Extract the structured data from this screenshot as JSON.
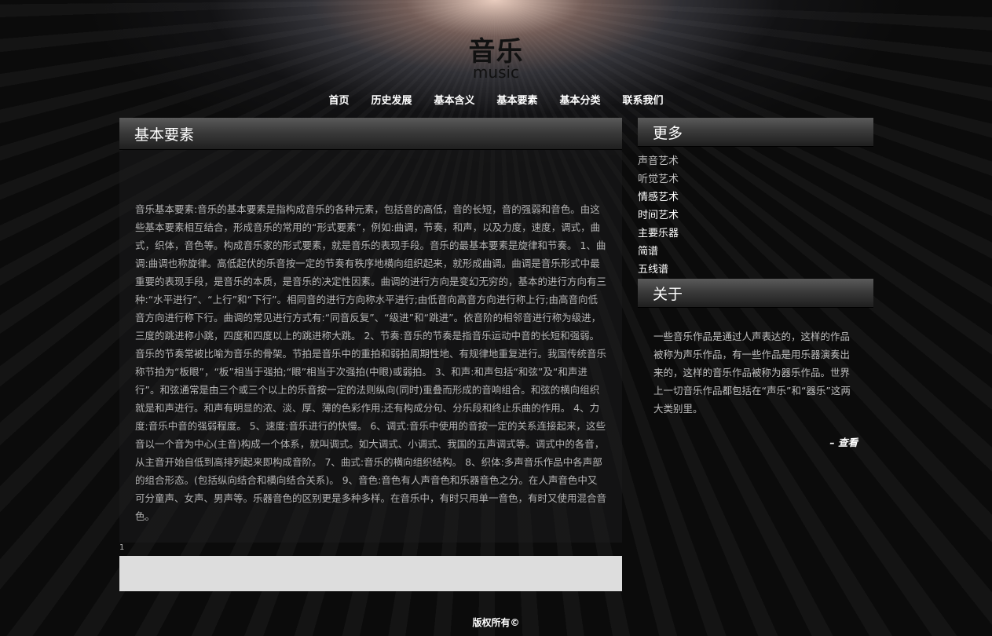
{
  "header": {
    "title": "音乐",
    "subtitle": "music"
  },
  "nav": {
    "items": [
      {
        "label": "首页"
      },
      {
        "label": "历史发展"
      },
      {
        "label": "基本含义"
      },
      {
        "label": "基本要素"
      },
      {
        "label": "基本分类"
      },
      {
        "label": "联系我们"
      }
    ]
  },
  "main": {
    "heading": "基本要素",
    "body": "音乐基本要素:音乐的基本要素是指构成音乐的各种元素，包括音的高低，音的长短，音的强弱和音色。由这些基本要素相互结合，形成音乐的常用的“形式要素”，例如:曲调，节奏，和声，以及力度，速度，调式，曲式，织体，音色等。构成音乐家的形式要素，就是音乐的表现手段。音乐的最基本要素是旋律和节奏。 1、曲调:曲调也称旋律。高低起伏的乐音按一定的节奏有秩序地横向组织起来，就形成曲调。曲调是音乐形式中最重要的表现手段，是音乐的本质，是音乐的决定性因素。曲调的进行方向是变幻无穷的，基本的进行方向有三种:“水平进行”、“上行”和“下行”。相同音的进行方向称水平进行;由低音向高音方向进行称上行;由高音向低音方向进行称下行。曲调的常见进行方式有:“同音反复”、“级进”和“跳进”。依音阶的相邻音进行称为级进，三度的跳进称小跳，四度和四度以上的跳进称大跳。 2、节奏:音乐的节奏是指音乐运动中音的长短和强弱。音乐的节奏常被比喻为音乐的骨架。节拍是音乐中的重拍和弱拍周期性地、有规律地重复进行。我国传统音乐称节拍为“板眼”，“板”相当于强拍;“眼”相当于次强拍(中眼)或弱拍。 3、和声:和声包括“和弦”及“和声进行”。和弦通常是由三个或三个以上的乐音按一定的法则纵向(同时)重叠而形成的音响组合。和弦的横向组织就是和声进行。和声有明显的浓、淡、厚、薄的色彩作用;还有构成分句、分乐段和终止乐曲的作用。 4、力度:音乐中音的强弱程度。 5、速度:音乐进行的快慢。 6、调式:音乐中使用的音按一定的关系连接起来，这些音以一个音为中心(主音)构成一个体系，就叫调式。如大调式、小调式、我国的五声调式等。调式中的各音，从主音开始自低到高排列起来即构成音阶。 7、曲式:音乐的横向组织结构。 8、织体:多声音乐作品中各声部的组合形态。(包括纵向结合和横向结合关系)。 9、音色:音色有人声音色和乐器音色之分。在人声音色中又可分童声、女声、男声等。乐器音色的区别更是多种多样。在音乐中，有时只用单一音色，有时又使用混合音色。",
    "page_number": "1"
  },
  "sidebar": {
    "more_heading": "更多",
    "more_items": [
      {
        "label": "声音艺术"
      },
      {
        "label": "听觉艺术"
      },
      {
        "label": "情感艺术"
      },
      {
        "label": "时间艺术"
      },
      {
        "label": "主要乐器"
      },
      {
        "label": "简谱"
      },
      {
        "label": "五线谱"
      }
    ],
    "about_heading": "关于",
    "about_text": "一些音乐作品是通过人声表达的，这样的作品被称为声乐作品，有一些作品是用乐器演奏出来的，这样的音乐作品被称为器乐作品。世界上一切音乐作品都包括在“声乐”和“器乐”这两大类别里。",
    "about_link": "– 查看"
  },
  "footer": {
    "copyright": "版权所有©"
  }
}
